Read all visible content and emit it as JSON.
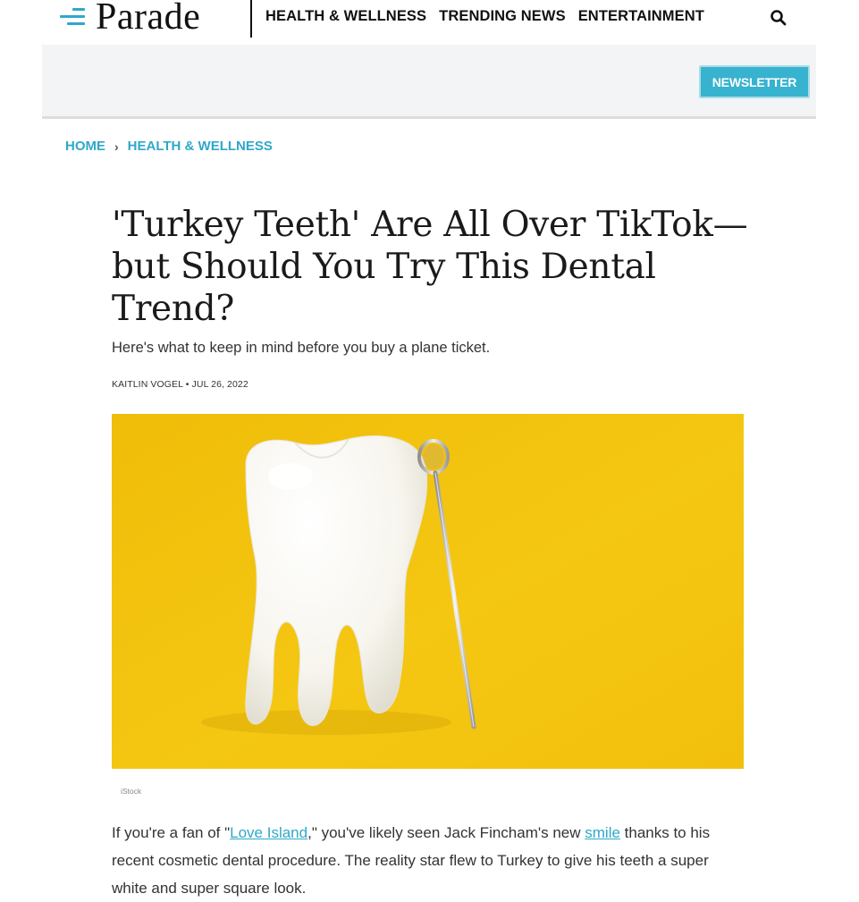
{
  "brand": {
    "logo_text": "Parade"
  },
  "nav": {
    "links": [
      "HEALTH & WELLNESS",
      "TRENDING NEWS",
      "ENTERTAINMENT"
    ]
  },
  "subheader": {
    "newsletter_label": "NEWSLETTER"
  },
  "breadcrumb": {
    "home": "HOME",
    "separator": "›",
    "section": "HEALTH & WELLNESS"
  },
  "article": {
    "headline": "'Turkey Teeth' Are All Over TikTok—but Should You Try This Dental Trend?",
    "dek": "Here's what to keep in mind before you buy a plane ticket.",
    "author": "KAITLIN VOGEL",
    "byline_separator": "•",
    "date": "JUL 26, 2022",
    "image_credit": "iStock",
    "body": {
      "part1": "If you're a fan of \"",
      "link1": "Love Island",
      "part2": ",\" you've likely seen Jack Fincham's new ",
      "link2": "smile",
      "part3": " thanks to his recent cosmetic dental procedure. The reality star flew to Turkey to give his teeth a super white and super square look."
    }
  },
  "icons": {
    "menu": "hamburger-menu-icon",
    "search": "search-icon"
  },
  "colors": {
    "accent": "#2fa8c9",
    "newsletter_bg": "#37b3d0",
    "hero_background": "#f2c20c",
    "subheader_bg": "#f3f4f5"
  }
}
